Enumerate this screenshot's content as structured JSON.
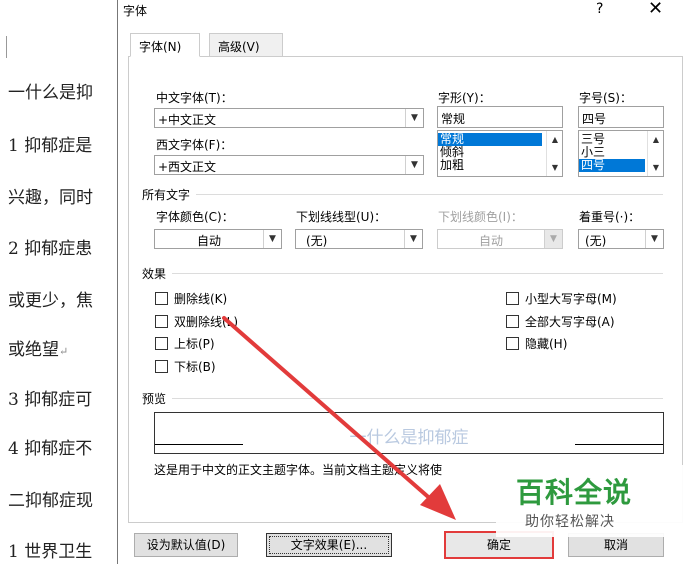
{
  "document": {
    "lines": [
      "一什么是抑",
      "1 抑郁症是",
      "兴趣，同时",
      "2 抑郁症患",
      "或更少，焦",
      "或绝望",
      "3 抑郁症可",
      "4 抑郁症不",
      "二抑郁症现",
      "1 世界卫生"
    ]
  },
  "dialog": {
    "title": "字体",
    "help": "?",
    "close": "✕",
    "tabs": [
      "字体(N)",
      "高级(V)"
    ]
  },
  "font_tab": {
    "chinese_font_label": "中文字体(T)：",
    "chinese_font_value": "+中文正文",
    "western_font_label": "西文字体(F)：",
    "western_font_value": "+西文正文",
    "style_label": "字形(Y)：",
    "style_value": "常规",
    "style_options": [
      "常规",
      "倾斜",
      "加粗"
    ],
    "size_label": "字号(S)：",
    "size_value": "四号",
    "size_options": [
      "三号",
      "小三",
      "四号"
    ]
  },
  "all_text": {
    "section": "所有文字",
    "font_color_label": "字体颜色(C)：",
    "font_color_value": "自动",
    "underline_style_label": "下划线线型(U)：",
    "underline_style_value": "(无)",
    "underline_color_label": "下划线颜色(I)：",
    "underline_color_value": "自动",
    "emphasis_label": "着重号(·)：",
    "emphasis_value": "(无)"
  },
  "effects": {
    "section": "效果",
    "left": [
      "删除线(K)",
      "双删除线(L)",
      "上标(P)",
      "下标(B)"
    ],
    "right": [
      "小型大写字母(M)",
      "全部大写字母(A)",
      "隐藏(H)"
    ]
  },
  "preview": {
    "section": "预览",
    "sample": "一什么是抑郁症",
    "description": "这是用于中文的正文主题字体。当前文档主题定义将使"
  },
  "buttons": {
    "set_default": "设为默认值(D)",
    "text_effects": "文字效果(E)...",
    "ok": "确定",
    "cancel": "取消"
  },
  "watermark": {
    "title": "百科全说",
    "subtitle": "助你轻松解决"
  },
  "colors": {
    "annotation_red": "#e23b3b",
    "selection": "#0078d7",
    "watermark_green": "#2e9a3e"
  }
}
